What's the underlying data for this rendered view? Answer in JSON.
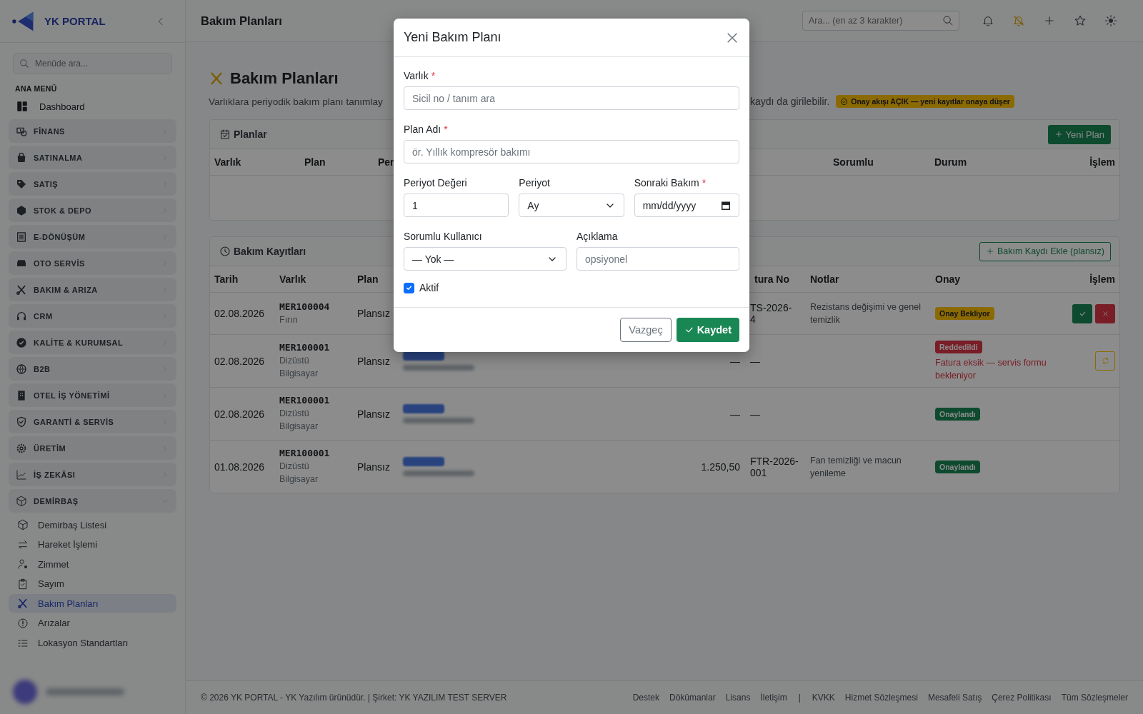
{
  "sidebar": {
    "logo_text": "YK PORTAL",
    "search": {
      "placeholder": "Menüde ara..."
    },
    "section_label": "ANA MENÜ",
    "items": [
      {
        "kind": "link",
        "label": "Dashboard",
        "selected": false
      },
      {
        "kind": "group",
        "label": "FİNANS",
        "expanded": false
      },
      {
        "kind": "group",
        "label": "SATINALMA",
        "expanded": false
      },
      {
        "kind": "group",
        "label": "SATIŞ",
        "expanded": false
      },
      {
        "kind": "group",
        "label": "STOK & DEPO",
        "expanded": false
      },
      {
        "kind": "group",
        "label": "E-DÖNÜŞÜM",
        "expanded": false
      },
      {
        "kind": "group",
        "label": "OTO SERVİS",
        "expanded": false
      },
      {
        "kind": "group",
        "label": "BAKIM & ARIZA",
        "expanded": false
      },
      {
        "kind": "group",
        "label": "CRM",
        "expanded": false
      },
      {
        "kind": "group",
        "label": "KALİTE & KURUMSAL",
        "expanded": false
      },
      {
        "kind": "group",
        "label": "B2B",
        "expanded": false
      },
      {
        "kind": "group",
        "label": "OTEL İŞ YÖNETİMİ",
        "expanded": false
      },
      {
        "kind": "group",
        "label": "GARANTİ & SERVİS",
        "expanded": false
      },
      {
        "kind": "group",
        "label": "ÜRETİM",
        "expanded": false
      },
      {
        "kind": "group",
        "label": "İŞ ZEKÂSI",
        "expanded": false
      },
      {
        "kind": "group",
        "label": "DEMİRBAŞ",
        "expanded": true,
        "children": [
          {
            "label": "Demirbaş Listesi",
            "selected": false
          },
          {
            "label": "Hareket İşlemi",
            "selected": false
          },
          {
            "label": "Zimmet",
            "selected": false
          },
          {
            "label": "Sayım",
            "selected": false
          },
          {
            "label": "Bakım Planları",
            "selected": true
          },
          {
            "label": "Arızalar",
            "selected": false
          },
          {
            "label": "Lokasyon Standartları",
            "selected": false
          }
        ]
      }
    ]
  },
  "topbar": {
    "title": "Bakım Planları",
    "search": {
      "placeholder": "Ara... (en az 3 karakter)"
    }
  },
  "page": {
    "title": "Bakım Planları",
    "description_start": "Varlıklara periyodik bakım planı tanımlay",
    "description_end": "kaydı da girilebilir.",
    "approval_badge": "Onay akışı AÇIK — yeni kayıtlar onaya düşer"
  },
  "plans_card": {
    "title": "Planlar",
    "new_button": "Yeni Plan",
    "columns": [
      "Varlık",
      "Plan",
      "Per",
      "Sorumlu",
      "Durum",
      "İşlem"
    ]
  },
  "records_card": {
    "title": "Bakım Kayıtları",
    "add_button": "Bakım Kaydı Ekle (plansız)",
    "columns": [
      "Tarih",
      "Varlık",
      "Plan",
      "tura No",
      "Notlar",
      "Onay",
      "İşlem"
    ],
    "rows": [
      {
        "date": "02.08.2026",
        "asset_code": "MER100004",
        "asset_name": "Fırın",
        "plan": "Plansız",
        "invoice": "TS-2026-\n4",
        "notes": "Rezistans değişimi ve genel temizlik",
        "status": {
          "kind": "pending",
          "label": "Onay Bekliyor"
        },
        "actions": [
          {
            "kind": "approve"
          },
          {
            "kind": "reject"
          }
        ]
      },
      {
        "date": "02.08.2026",
        "asset_code": "MER100001",
        "asset_name": "Dizüstü Bilgisayar",
        "plan": "Plansız",
        "amount": "—",
        "invoice": "—",
        "status": {
          "kind": "rejected",
          "label": "Reddedildi",
          "note": "Fatura eksik — servis formu bekleniyor"
        },
        "actions": [
          {
            "kind": "resubmit"
          }
        ]
      },
      {
        "date": "02.08.2026",
        "asset_code": "MER100001",
        "asset_name": "Dizüstü Bilgisayar",
        "plan": "Plansız",
        "amount": "—",
        "invoice": "—",
        "status": {
          "kind": "approved",
          "label": "Onaylandı"
        }
      },
      {
        "date": "01.08.2026",
        "asset_code": "MER100001",
        "asset_name": "Dizüstü Bilgisayar",
        "plan": "Plansız",
        "amount": "1.250,50",
        "invoice": "FTR-2026-001",
        "notes": "Fan temizliği ve macun yenileme",
        "status": {
          "kind": "approved",
          "label": "Onaylandı"
        }
      }
    ]
  },
  "modal": {
    "title": "Yeni Bakım Planı",
    "fields": [
      {
        "kind": "input",
        "label": "Varlık",
        "required_mark": "*",
        "placeholder": "Sicil no / tanım ara"
      },
      {
        "kind": "input",
        "label": "Plan Adı",
        "required_mark": "*",
        "placeholder": "ör. Yıllık kompresör bakımı"
      },
      {
        "kind": "input",
        "label": "Periyot Değeri",
        "value": "1"
      },
      {
        "kind": "select",
        "label": "Periyot",
        "value": "Ay"
      },
      {
        "kind": "date",
        "label": "Sonraki Bakım",
        "required_mark": "*",
        "placeholder": "mm/dd/yyyy"
      },
      {
        "kind": "select",
        "label": "Sorumlu Kullanıcı",
        "value": "— Yok —"
      },
      {
        "kind": "input",
        "label": "Açıklama",
        "placeholder": "opsiyonel"
      }
    ],
    "active": {
      "label": "Aktif",
      "checked": true
    },
    "cancel_button": "Vazgeç",
    "save_button": "Kaydet"
  },
  "footer": {
    "copyright": "© 2026 YK PORTAL - YK Yazılım ürünüdür. | Şirket: YK YAZILIM TEST SERVER",
    "links_left": [
      "Destek",
      "Dökümanlar",
      "Lisans",
      "İletişim"
    ],
    "separator": "|",
    "links_right": [
      "KVKK",
      "Hizmet Sözleşmesi",
      "Mesafeli Satış",
      "Çerez Politikası",
      "Tüm Sözleşmeler"
    ]
  }
}
